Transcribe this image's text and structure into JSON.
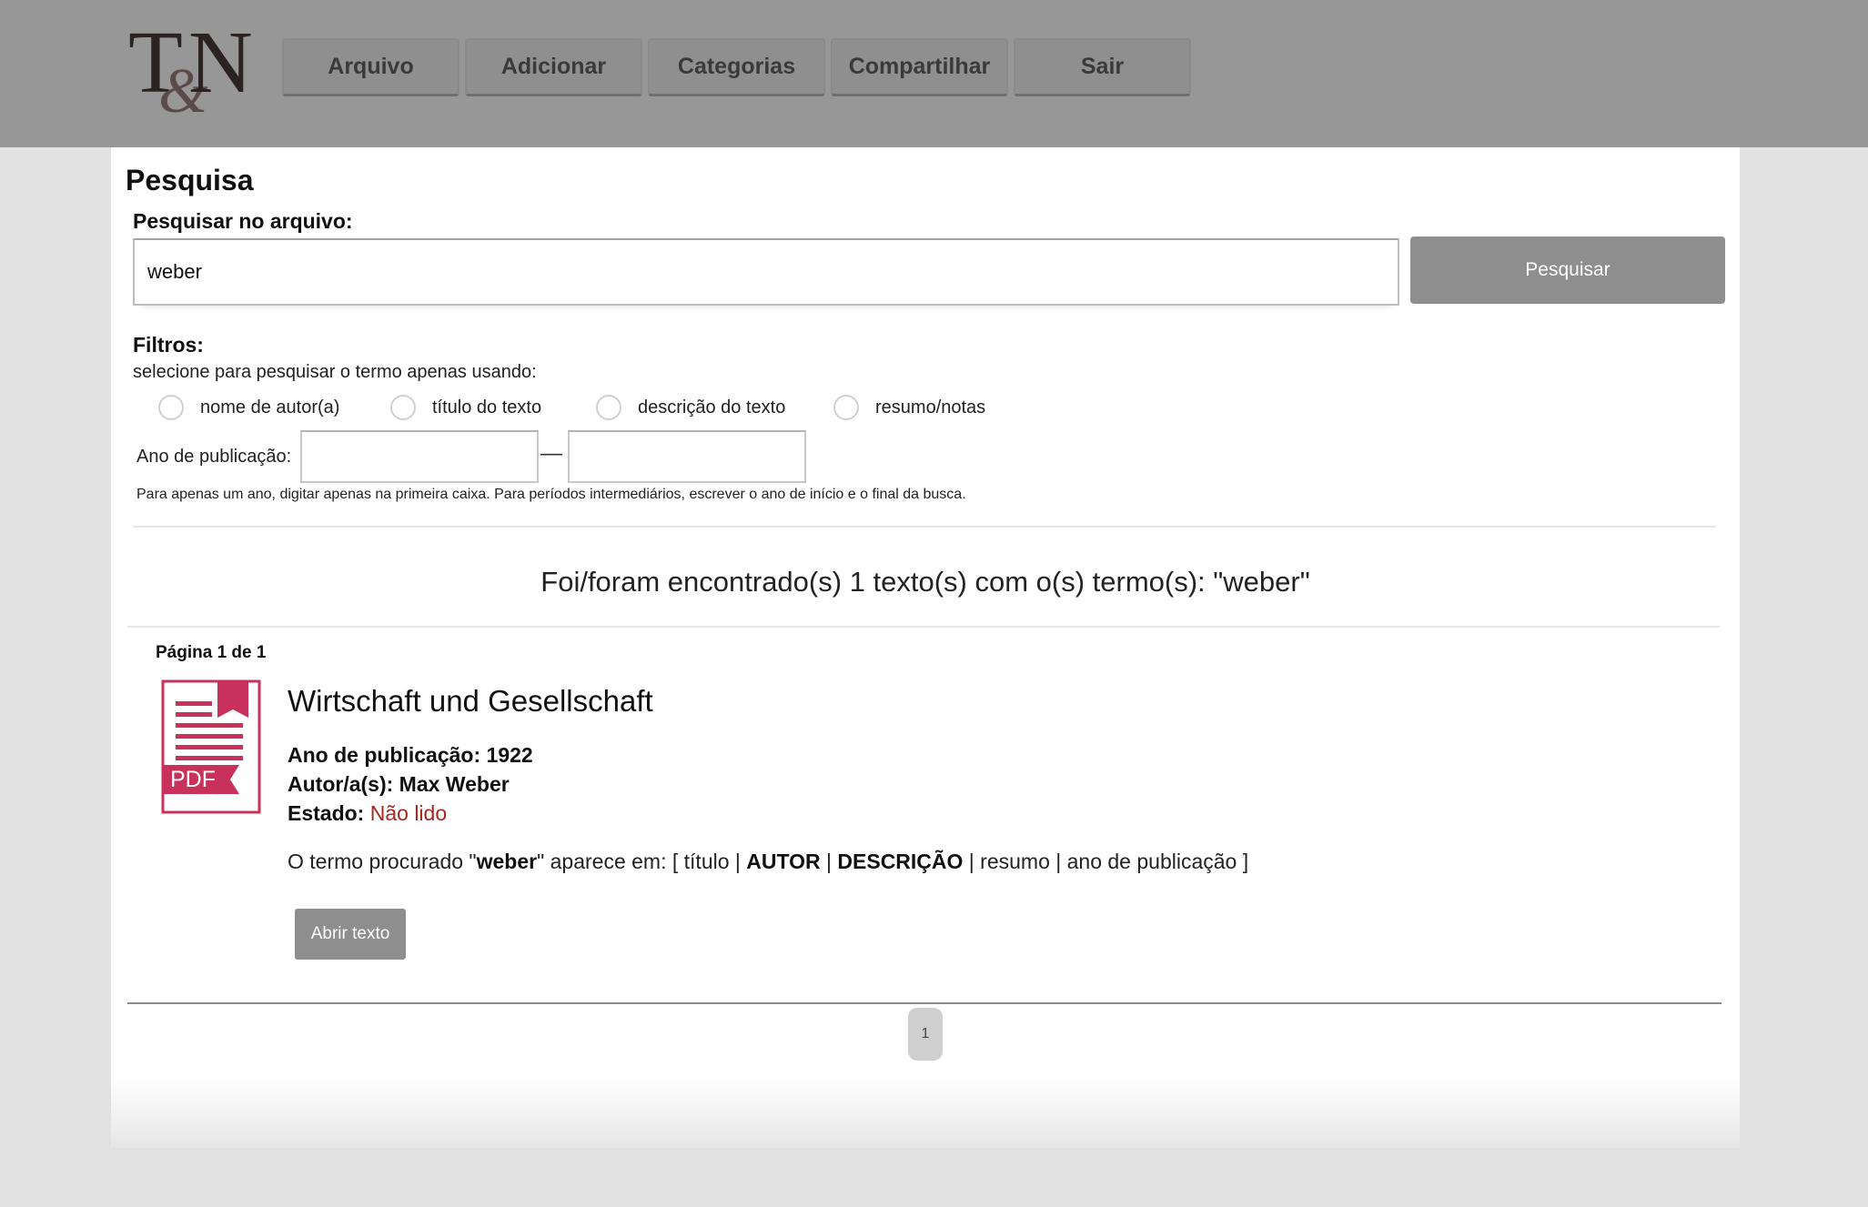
{
  "header": {
    "logo": {
      "top": "T",
      "amp": "&",
      "bottom": "N"
    },
    "nav": [
      "Arquivo",
      "Adicionar",
      "Categorias",
      "Compartilhar",
      "Sair"
    ]
  },
  "search": {
    "heading": "Pesquisa",
    "label": "Pesquisar no arquivo:",
    "value": "weber",
    "button": "Pesquisar"
  },
  "filters": {
    "heading": "Filtros:",
    "hint": "selecione para pesquisar o termo apenas usando:",
    "options": [
      "nome de autor(a)",
      "título do texto",
      "descrição do texto",
      "resumo/notas"
    ],
    "year_label": "Ano de publicação:",
    "year_from": "",
    "year_to": "",
    "year_dash": "—",
    "year_hint": "Para apenas um ano, digitar apenas na primeira caixa. Para períodos intermediários, escrever o ano de início e o final da busca."
  },
  "results": {
    "summary": "Foi/foram encontrado(s) 1 texto(s) com o(s) termo(s): \"weber\"",
    "page_info": "Página 1 de 1",
    "items": [
      {
        "icon": "pdf-icon",
        "icon_label": "PDF",
        "title": "Wirtschaft und Gesellschaft",
        "year_label": "Ano de publicação:",
        "year": "1922",
        "author_label": "Autor/a(s):",
        "author": "Max Weber",
        "status_label": "Estado:",
        "status": "Não lido",
        "status_color": "#a5281c",
        "term_prefix": "O termo procurado \"",
        "term": "weber",
        "term_middle": "\" aparece em: [ título | ",
        "term_author": "AUTOR",
        "term_sep1": " | ",
        "term_desc": "DESCRIÇÃO",
        "term_suffix": " | resumo | ano de publicação ]",
        "open_button": "Abrir texto"
      }
    ],
    "pages": [
      "1"
    ]
  }
}
